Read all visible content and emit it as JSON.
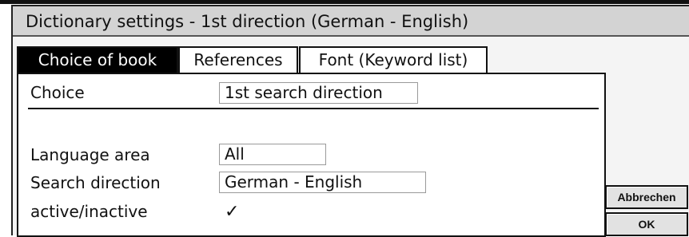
{
  "window": {
    "title": "Dictionary settings - 1st direction (German - English)"
  },
  "tabs": [
    {
      "label": "Choice of book",
      "active": true
    },
    {
      "label": "References",
      "active": false
    },
    {
      "label": "Font (Keyword list)",
      "active": false
    }
  ],
  "form": {
    "choice": {
      "label": "Choice",
      "value": "1st search direction"
    },
    "language_area": {
      "label": "Language area",
      "value": "All"
    },
    "search_direction": {
      "label": "Search direction",
      "value": "German - English"
    },
    "active": {
      "label": "active/inactive",
      "checked": true,
      "check_glyph": "✓"
    }
  },
  "buttons": {
    "cancel": "Abbrechen",
    "ok": "OK"
  }
}
